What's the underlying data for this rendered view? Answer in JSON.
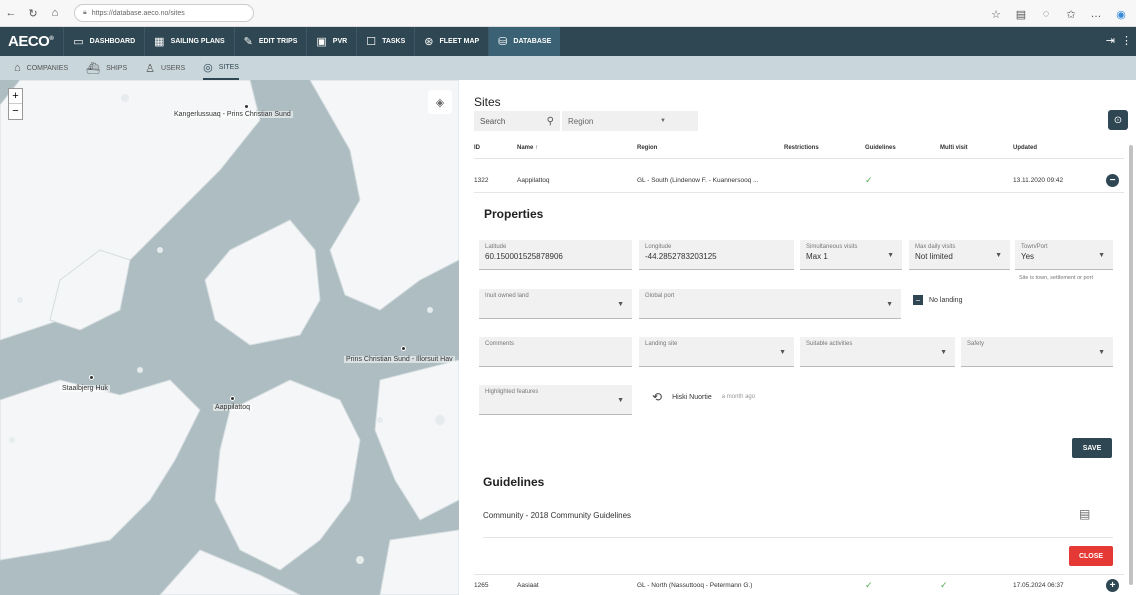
{
  "browser": {
    "url": "https://database.aeco.no/sites",
    "icons": [
      "back-icon",
      "refresh-icon",
      "home-icon",
      "lock-icon",
      "star-icon",
      "reading-icon",
      "refresh-alt-icon",
      "favorites-icon",
      "more-icon",
      "edge-icon"
    ]
  },
  "app": {
    "logo": "AECO",
    "logo_mark": "®",
    "nav": [
      {
        "label": "DASHBOARD",
        "icon": "dashboard-icon"
      },
      {
        "label": "SAILING PLANS",
        "icon": "calendar-icon"
      },
      {
        "label": "EDIT TRIPS",
        "icon": "edit-icon"
      },
      {
        "label": "PVR",
        "icon": "clipboard-icon"
      },
      {
        "label": "TASKS",
        "icon": "tasks-icon"
      },
      {
        "label": "FLEET MAP",
        "icon": "compass-icon"
      },
      {
        "label": "DATABASE",
        "icon": "database-icon",
        "active": true
      }
    ],
    "right_icons": [
      "logout-icon",
      "more-vert-icon"
    ]
  },
  "subnav": [
    {
      "label": "COMPANIES",
      "icon": "building-icon"
    },
    {
      "label": "SHIPS",
      "icon": "ship-icon"
    },
    {
      "label": "USERS",
      "icon": "users-icon"
    },
    {
      "label": "SITES",
      "icon": "pin-icon",
      "active": true
    }
  ],
  "map": {
    "zoom_in": "+",
    "zoom_out": "−",
    "labels": {
      "kangerluk": "Kangerlussuaq - Prins Christian Sund",
      "christian": "Prins Christian Sund - Illorsuit Hav",
      "staalbjerg": "Staalbjerg Huk",
      "aappilattoq": "Aappilattoq"
    }
  },
  "sites": {
    "title": "Sites",
    "search_label": "Search",
    "region_placeholder": "Region",
    "columns": [
      "ID",
      "Name ↑",
      "Region",
      "Restrictions",
      "Guidelines",
      "Multi visit",
      "Updated"
    ],
    "rows": [
      {
        "id": "1322",
        "name": "Aappilattoq",
        "region": "GL - South (Lindenow F. - Kuannersooq ...",
        "restrictions": "",
        "guidelines": "✓",
        "multi": "",
        "updated": "13.11.2020 09:42",
        "expand": "−"
      },
      {
        "id": "1265",
        "name": "Aasiaat",
        "region": "GL - North (Nassuttooq - Petermann G.)",
        "restrictions": "",
        "guidelines": "✓",
        "multi": "✓",
        "updated": "17.05.2024 06:37",
        "expand": "+"
      }
    ]
  },
  "properties": {
    "title": "Properties",
    "latitude": {
      "label": "Latitude",
      "value": "60.150001525878906"
    },
    "longitude": {
      "label": "Longitude",
      "value": "-44.2852783203125"
    },
    "simultaneous": {
      "label": "Simultaneous visits",
      "value": "Max 1"
    },
    "max_daily": {
      "label": "Max daily visits",
      "value": "Not limited"
    },
    "town_port": {
      "label": "Town/Port",
      "value": "Yes",
      "hint": "Site is town, settlement or port"
    },
    "inuit_land": {
      "label": "Inuit owned land",
      "value": ""
    },
    "global_port": {
      "label": "Global port",
      "value": ""
    },
    "no_landing": {
      "label": "No landing",
      "checked": true
    },
    "comments": {
      "label": "Comments"
    },
    "landing_site": {
      "label": "Landing site"
    },
    "suitable": {
      "label": "Suitable activities"
    },
    "safety": {
      "label": "Safety"
    },
    "highlighted": {
      "label": "Highlighted features"
    },
    "history": {
      "user": "Hiski Nuortie",
      "when": "a month ago"
    },
    "save_label": "SAVE"
  },
  "guidelines": {
    "title": "Guidelines",
    "item": "Community - 2018 Community Guidelines",
    "close_label": "CLOSE"
  }
}
